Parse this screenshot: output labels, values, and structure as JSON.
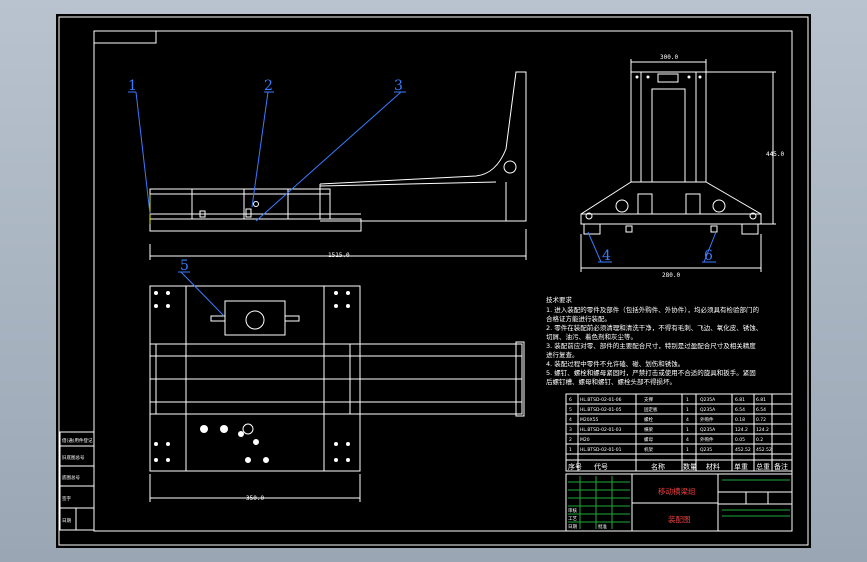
{
  "dimensions": {
    "side_length": "1515.0",
    "top_width": "300.0",
    "front_height": "445.0",
    "front_base": "280.0",
    "plan_width": "350.0"
  },
  "balloons": [
    "1",
    "2",
    "3",
    "4",
    "5",
    "6"
  ],
  "notes": {
    "title": "技术要求",
    "lines": [
      "1. 进入装配的零件及部件（包括外购件、外协件），均必须具有检验部门的",
      "合格证方能进行装配。",
      "2. 零件在装配前必须清理和清洗干净，不得有毛刺、飞边、氧化皮、锈蚀、",
      "切屑、油污、着色剂和灰尘等。",
      "3. 装配前应对零、部件的主要配合尺寸，特别是过盈配合尺寸及相关精度",
      "进行复查。",
      "4. 装配过程中零件不允许磕、碰、划伤和锈蚀。",
      "5. 螺钉、螺栓和螺母紧固时，严禁打击或使用不合适的旋具和扳手。紧固",
      "后螺钉槽、螺母和螺钉、螺栓头部不得损坏。"
    ]
  },
  "bom": {
    "rows": [
      {
        "no": "6",
        "code": "HL.BTSD-02-01-06",
        "name": "支撑",
        "qty": "1",
        "mat": "Q235A",
        "unit": "6.81",
        "total": "6.81"
      },
      {
        "no": "5",
        "code": "HL.BTSD-02-01-05",
        "name": "固定板",
        "qty": "1",
        "mat": "Q235A",
        "unit": "6.54",
        "total": "6.54"
      },
      {
        "no": "4",
        "code": "M20X55",
        "name": "螺栓",
        "qty": "4",
        "mat": "外购件",
        "unit": "0.18",
        "total": "0.72"
      },
      {
        "no": "3",
        "code": "HL.BTSD-02-01-03",
        "name": "横梁",
        "qty": "1",
        "mat": "Q235A",
        "unit": "124.2",
        "total": "124.2"
      },
      {
        "no": "2",
        "code": "M20",
        "name": "螺母",
        "qty": "4",
        "mat": "外购件",
        "unit": "0.05",
        "total": "0.2"
      },
      {
        "no": "1",
        "code": "HL.BTSD-02-01-01",
        "name": "机架",
        "qty": "1",
        "mat": "Q235",
        "unit": "452.52",
        "total": "452.52"
      }
    ],
    "headers": [
      "序号",
      "代号",
      "名称",
      "数量",
      "材料",
      "单重",
      "总重",
      "备注"
    ]
  },
  "title_block": {
    "title": "移动横梁组",
    "subtitle": "装配图",
    "left_labels": [
      "审核",
      "工艺",
      "日期",
      "批准"
    ]
  },
  "side_stamps": [
    "借(通)用件登记",
    "旧底图总号",
    "底图总号",
    "签字",
    "日期"
  ],
  "colors": {
    "background": "#000000",
    "line": "#ffffff",
    "leader": "#3a7bff",
    "hidden": "#e8e800",
    "sheet": "#a8b3bf"
  }
}
